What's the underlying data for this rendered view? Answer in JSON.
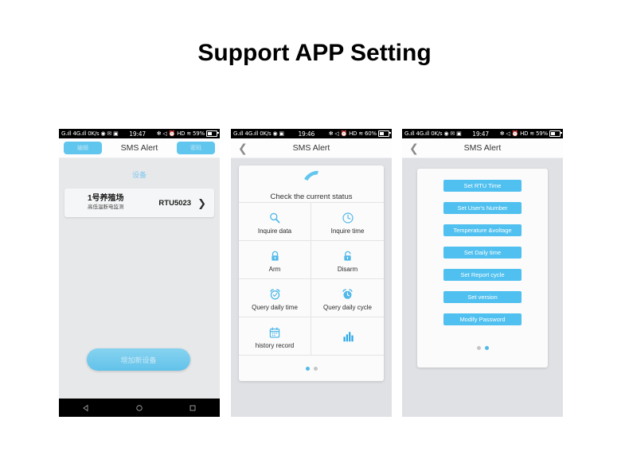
{
  "page": {
    "title": "Support APP Setting"
  },
  "statusbar": {
    "carrier": "G.ıll 4G.ıll",
    "netspeed": "0K/s",
    "icons_left": [
      "sync-icon",
      "message-icon",
      "sim-icon"
    ],
    "icons_right": [
      "bluetooth-icon",
      "mute-icon",
      "alarm-icon",
      "hd-icon",
      "wifi-icon"
    ],
    "time_1": "19:47",
    "battery_1": "59%",
    "time_2": "19:46",
    "battery_2": "60%",
    "time_3": "19:47",
    "battery_3": "59%"
  },
  "colors": {
    "accent": "#53b9e8",
    "command_button": "#4fc0ef",
    "screen_bg": "#dfe1e5",
    "card_bg": "#fbfbfb"
  },
  "screen1": {
    "title": "SMS Alert",
    "left_button": "编辑",
    "right_button": "密码",
    "section_label": "设备",
    "device": {
      "name": "1号养殖场",
      "subtitle": "高低温断电监测",
      "model": "RTU5023",
      "arrow": "❯"
    },
    "add_button": "增加新设备",
    "navbar": [
      "back-icon",
      "home-icon",
      "recents-icon"
    ]
  },
  "screen2": {
    "title": "SMS Alert",
    "back": "❮",
    "call_cell": {
      "icon": "phone-call-icon",
      "label": "Check the current status"
    },
    "grid": [
      {
        "icon": "magnifier-icon",
        "label": "Inquire data"
      },
      {
        "icon": "clock-icon",
        "label": "Inquire time"
      },
      {
        "icon": "lock-closed-icon",
        "label": "Arm"
      },
      {
        "icon": "lock-open-icon",
        "label": "Disarm"
      },
      {
        "icon": "alarm-clock-check-icon",
        "label": "Query daily time"
      },
      {
        "icon": "alarm-clock-icon",
        "label": "Query daily cycle"
      },
      {
        "icon": "calendar-icon",
        "label": "history record"
      },
      {
        "icon": "bar-chart-icon",
        "label": ""
      }
    ],
    "page_dots": {
      "count": 2,
      "active": 1
    }
  },
  "screen3": {
    "title": "SMS Alert",
    "back": "❮",
    "commands": [
      "Set RTU Time",
      "Set User's Number",
      "Temperature &voltage",
      "Set Daily time",
      "Set Report cycle",
      "Set version",
      "Modify Password"
    ],
    "page_dots": {
      "count": 2,
      "active": 2
    }
  }
}
